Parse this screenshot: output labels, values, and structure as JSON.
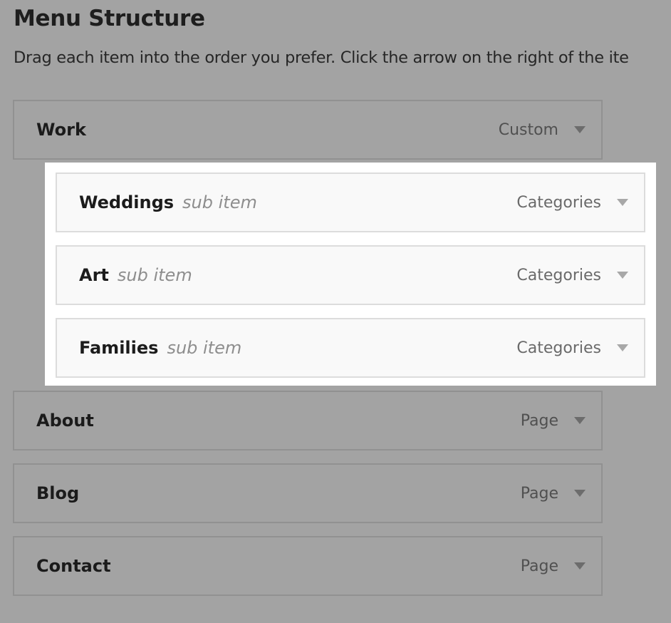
{
  "header": {
    "title": "Menu Structure",
    "instructions": "Drag each item into the order you prefer. Click the arrow on the right of the ite"
  },
  "menu_items": [
    {
      "label": "Work",
      "type": "Custom"
    },
    {
      "label": "Weddings",
      "sublabel": "sub item",
      "type": "Categories"
    },
    {
      "label": "Art",
      "sublabel": "sub item",
      "type": "Categories"
    },
    {
      "label": "Families",
      "sublabel": "sub item",
      "type": "Categories"
    },
    {
      "label": "About",
      "type": "Page"
    },
    {
      "label": "Blog",
      "type": "Page"
    },
    {
      "label": "Contact",
      "type": "Page"
    }
  ],
  "colors": {
    "overlay": "#a3a3a3",
    "highlight": "#ffffff",
    "sub_item_bg": "#f9f9f9"
  },
  "icons": {
    "expand": "triangle-down-icon"
  }
}
